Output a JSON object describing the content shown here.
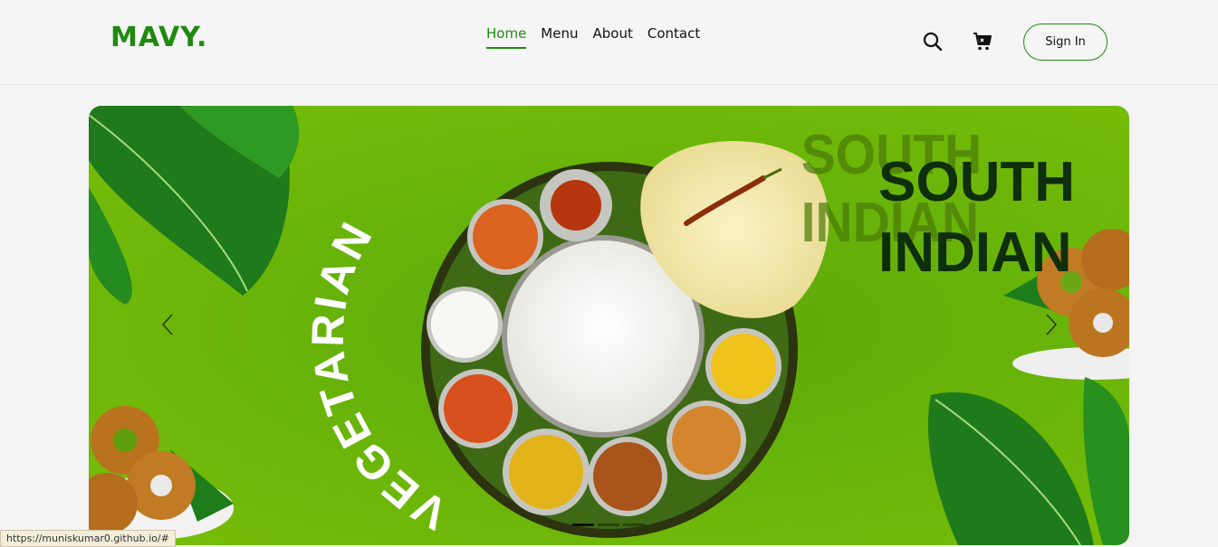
{
  "brand": {
    "logo": "MAVY."
  },
  "nav": {
    "items": [
      {
        "label": "Home",
        "active": true
      },
      {
        "label": "Menu",
        "active": false
      },
      {
        "label": "About",
        "active": false
      },
      {
        "label": "Contact",
        "active": false
      }
    ]
  },
  "header": {
    "search_icon": "search-icon",
    "cart_icon": "cart-icon",
    "signin_label": "Sign In"
  },
  "hero": {
    "text_curved": "VEGETARIAN",
    "text_heading_line1": "SOUTH",
    "text_heading_line2": "INDIAN",
    "slides_count": 3,
    "active_slide": 1
  },
  "colors": {
    "accent": "#1f8a0f",
    "hero_bg": "#66b20a",
    "heading_dark": "#0f2e0c"
  },
  "status_bar": {
    "url": "https://muniskumar0.github.io/#"
  }
}
